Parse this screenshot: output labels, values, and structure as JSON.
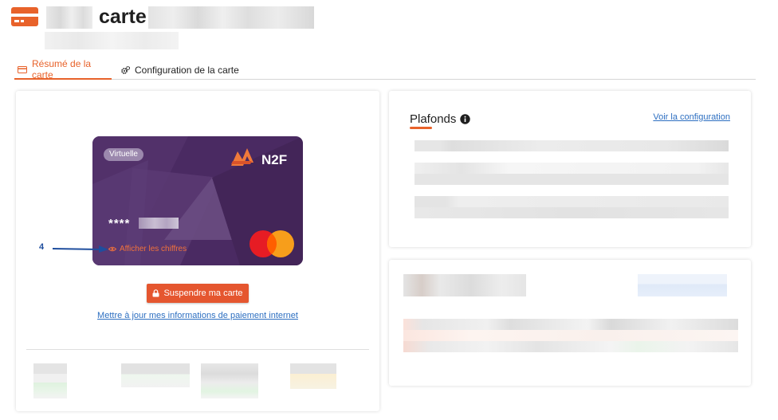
{
  "header": {
    "title": "carte",
    "icon": "credit-card-icon",
    "accent_color": "#e8622a"
  },
  "tabs": [
    {
      "label": "Résumé de la carte",
      "icon": "credit-card-icon",
      "active": true
    },
    {
      "label": "Configuration de la carte",
      "icon": "gears-icon",
      "active": false
    }
  ],
  "card": {
    "type_badge": "Virtuelle",
    "brand_logo": "N2F",
    "masked_number": "****",
    "show_digits_label": "Afficher les chiffres",
    "network_icon": "mastercard-icon",
    "background_color": "#4a2a62"
  },
  "annotation": {
    "number": "4"
  },
  "actions": {
    "suspend_label": "Suspendre ma carte",
    "update_payment_link": "Mettre à jour mes informations de paiement internet"
  },
  "plafonds": {
    "title": "Plafonds",
    "info_icon": "info-icon",
    "config_link": "Voir la configuration"
  }
}
